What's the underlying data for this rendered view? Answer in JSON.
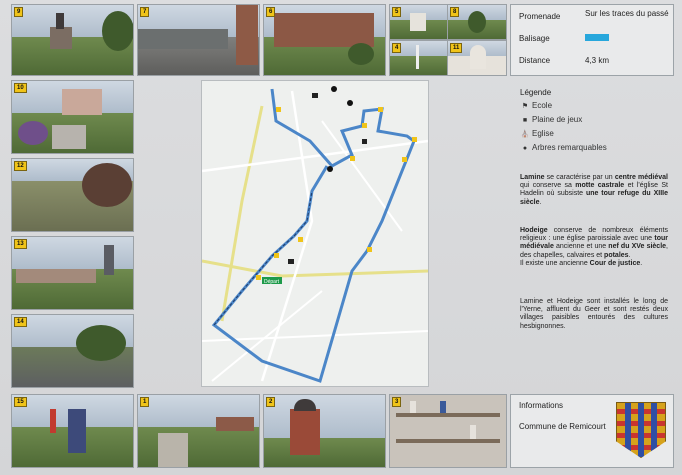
{
  "photos": {
    "n9": "9",
    "n7": "7",
    "n6": "6",
    "n5": "5",
    "n8": "8",
    "n4": "4",
    "n11": "11",
    "n10": "10",
    "n12": "12",
    "n13": "13",
    "n14": "14",
    "n15": "15",
    "n1": "1",
    "n2": "2",
    "n3": "3"
  },
  "route_panel": {
    "promenade_label": "Promenade",
    "promenade_value": "Sur les traces du passé",
    "balisage_label": "Balisage",
    "balisage_color": "#27a7dc",
    "distance_label": "Distance",
    "distance_value": "4,3 km"
  },
  "legend": {
    "title": "Légende",
    "items": [
      {
        "icon": "flag-icon",
        "label": "Ecole"
      },
      {
        "icon": "square-icon",
        "label": "Plaine de jeux"
      },
      {
        "icon": "church-icon",
        "label": "Eglise"
      },
      {
        "icon": "tree-icon",
        "label": "Arbres remarquables"
      }
    ]
  },
  "description": {
    "p1": {
      "t1": "Lamine",
      "t2": " se caractérise par un ",
      "t3": "centre médiéval",
      "t4": " qui conserve sa ",
      "t5": "motte castrale",
      "t6": " et l'église St Hadelin où subsiste ",
      "t7": "une tour refuge du XIIIe siècle",
      "t8": "."
    },
    "p2": {
      "t1": "Hodeige",
      "t2": " conserve de nombreux éléments religieux : une église paroissiale avec une ",
      "t3": "tour médiévale",
      "t4": " ancienne et une ",
      "t5": "nef du XVe siècle",
      "t6": ", des chapelles, calvaires et ",
      "t7": "potales",
      "t8": ".",
      "t9": "Il existe une ancienne ",
      "t10": "Cour de justice",
      "t11": "."
    },
    "p3": "Lamine et Hodeige sont installés le long de l'Yerne, affluent du Geer et sont restés deux villages paisibles entourés des cultures hesbignonnes."
  },
  "info": {
    "title": "Informations",
    "commune": "Commune de Remicourt"
  },
  "map": {
    "start_label": "Départ",
    "waypoints": [
      "1",
      "2",
      "3",
      "4",
      "5",
      "6",
      "7",
      "8",
      "9",
      "10",
      "11",
      "12",
      "13",
      "14",
      "15"
    ],
    "route_color": "#4b86c8"
  }
}
